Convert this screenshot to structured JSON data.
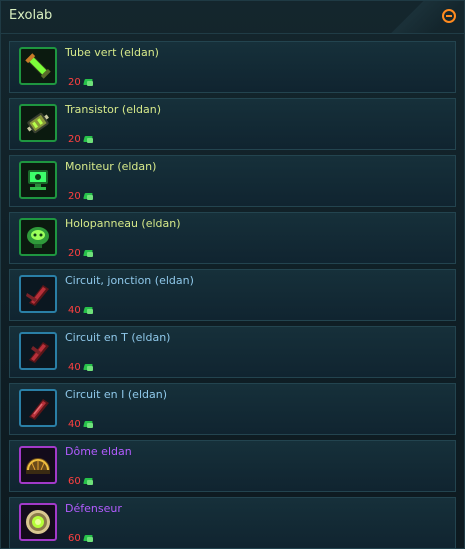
{
  "panel": {
    "title": "Exolab"
  },
  "items": [
    {
      "name": "Tube vert (eldan)",
      "price": "20",
      "rarity": "green",
      "icon": "green-tube-icon"
    },
    {
      "name": "Transistor (eldan)",
      "price": "20",
      "rarity": "green",
      "icon": "transistor-icon"
    },
    {
      "name": "Moniteur (eldan)",
      "price": "20",
      "rarity": "green",
      "icon": "monitor-icon"
    },
    {
      "name": "Holopanneau (eldan)",
      "price": "20",
      "rarity": "green",
      "icon": "holopanel-icon"
    },
    {
      "name": "Circuit, jonction (eldan)",
      "price": "40",
      "rarity": "blue",
      "icon": "circuit-junction-icon"
    },
    {
      "name": "Circuit en T (eldan)",
      "price": "40",
      "rarity": "blue",
      "icon": "circuit-t-icon"
    },
    {
      "name": "Circuit en I (eldan)",
      "price": "40",
      "rarity": "blue",
      "icon": "circuit-i-icon"
    },
    {
      "name": "Dôme eldan",
      "price": "60",
      "rarity": "purple",
      "icon": "dome-icon"
    },
    {
      "name": "Défenseur",
      "price": "60",
      "rarity": "purple",
      "icon": "defender-icon"
    }
  ],
  "colors": {
    "green_name": "#d6e98a",
    "blue_name": "#8fc8ea",
    "purple_name": "#b35cff",
    "price": "#ff4040",
    "collapse_button": "#ff8a1e"
  }
}
